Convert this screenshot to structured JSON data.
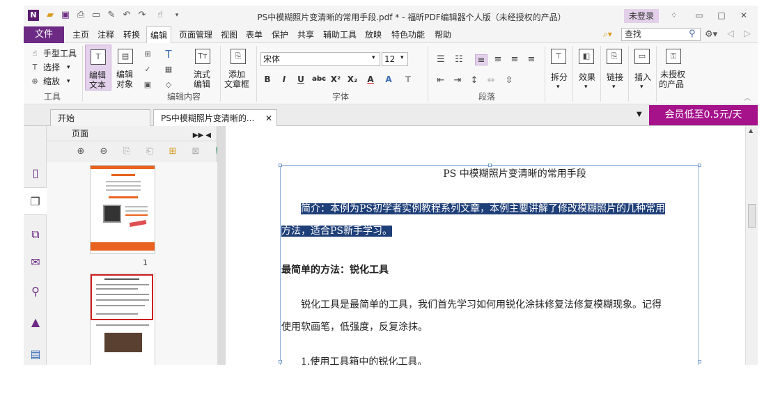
{
  "titlebar": {
    "title": "PS中模糊照片变清晰的常用手段.pdf * - 福昕PDF编辑器个人版（未经授权的产品）",
    "login": "未登录"
  },
  "menu": {
    "file": "文件",
    "items": [
      "主页",
      "注释",
      "转换",
      "编辑",
      "页面管理",
      "视图",
      "表单",
      "保护",
      "共享",
      "辅助工具",
      "放映",
      "特色功能",
      "帮助"
    ],
    "active": "编辑",
    "search_placeholder": "查找"
  },
  "ribbon": {
    "tools": {
      "hand": "手型工具",
      "select": "选择",
      "zoom": "缩放",
      "group": "工具"
    },
    "edit": {
      "edit_text": [
        "编辑",
        "文本"
      ],
      "edit_object": [
        "编辑",
        "对象"
      ],
      "flow_edit": [
        "流式",
        "编辑"
      ],
      "add_textbox": [
        "添加",
        "文章框"
      ],
      "group": "编辑内容"
    },
    "font": {
      "name": "宋体",
      "size": "12",
      "group": "字体",
      "buttons": [
        "B",
        "I",
        "U",
        "abc",
        "X²",
        "X₂",
        "A",
        "A",
        "T"
      ]
    },
    "paragraph": {
      "group": "段落"
    },
    "split": "拆分",
    "effect": "效果",
    "link": "链接",
    "insert": "插入",
    "unauthorized": [
      "未授权",
      "的产品"
    ]
  },
  "tabs": {
    "start": "开始",
    "doc": "PS中模糊照片变清晰的...",
    "promo": "会员低至0.5元/天"
  },
  "pages_panel": {
    "title": "页面",
    "thumbs": [
      {
        "num": "1"
      },
      {
        "num": ""
      }
    ]
  },
  "document": {
    "title": "PS 中模糊照片变清晰的常用手段",
    "intro_line1": "简介：本例为PS初学者实例教程系列文章，本例主要讲解了修改模糊照片的几种常用",
    "intro_line2": "方法，适合PS新手学习。",
    "heading": "最简单的方法：锐化工具",
    "para_line1": "锐化工具是最简单的工具，我们首先学习如何用锐化涂抹修复法修复模糊现象。记得",
    "para_line2": "使用软画笔，低强度，反复涂抹。",
    "step1": "1.使用工具箱中的锐化工具。"
  }
}
